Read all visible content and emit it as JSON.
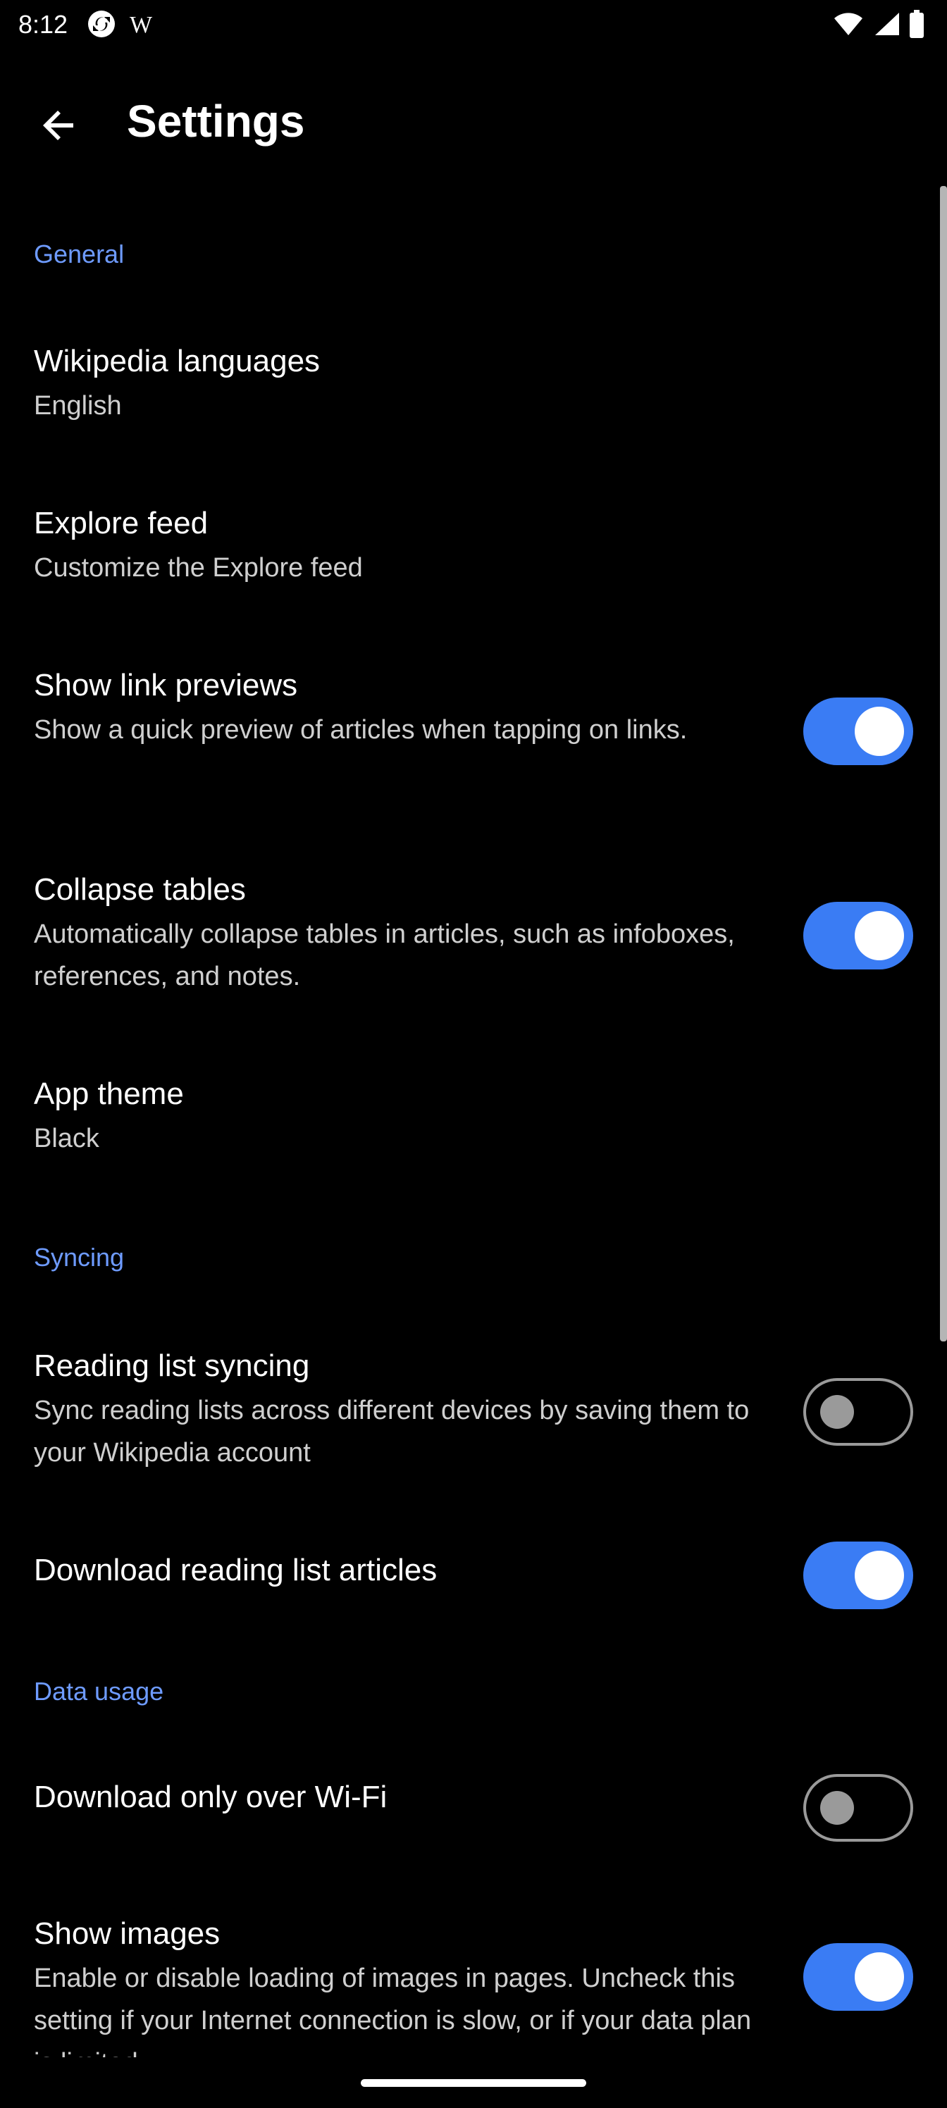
{
  "status_bar": {
    "time": "8:12",
    "left_icons": [
      "sync-icon",
      "wikipedia-w-icon"
    ],
    "wiki_glyph": "W",
    "right_icons": [
      "wifi-icon",
      "cellular-signal-icon",
      "battery-icon"
    ]
  },
  "app_bar": {
    "back_icon": "arrow-back-icon",
    "title": "Settings"
  },
  "sections": {
    "general": {
      "header": "General",
      "wikipedia_languages": {
        "title": "Wikipedia languages",
        "summary": "English"
      },
      "explore_feed": {
        "title": "Explore feed",
        "summary": "Customize the Explore feed"
      },
      "show_link_previews": {
        "title": "Show link previews",
        "summary": "Show a quick preview of articles when tapping on links.",
        "enabled": true
      },
      "collapse_tables": {
        "title": "Collapse tables",
        "summary": "Automatically collapse tables in articles, such as infoboxes, references, and notes.",
        "enabled": true
      },
      "app_theme": {
        "title": "App theme",
        "summary": "Black"
      }
    },
    "syncing": {
      "header": "Syncing",
      "reading_list_syncing": {
        "title": "Reading list syncing",
        "summary": "Sync reading lists across different devices by saving them to your Wikipedia account",
        "enabled": false
      },
      "download_reading_list_articles": {
        "title": "Download reading list articles",
        "enabled": true
      }
    },
    "data_usage": {
      "header": "Data usage",
      "download_only_over_wifi": {
        "title": "Download only over Wi-Fi",
        "enabled": false
      },
      "show_images": {
        "title": "Show images",
        "summary": "Enable or disable loading of images in pages. Uncheck this setting if your Internet connection is slow, or if your data plan is limited.",
        "enabled": true
      }
    }
  },
  "colors": {
    "background": "#000000",
    "accent": "#3a7cf4",
    "section_header": "#6e9bff",
    "summary_text": "#cfcfcf"
  }
}
